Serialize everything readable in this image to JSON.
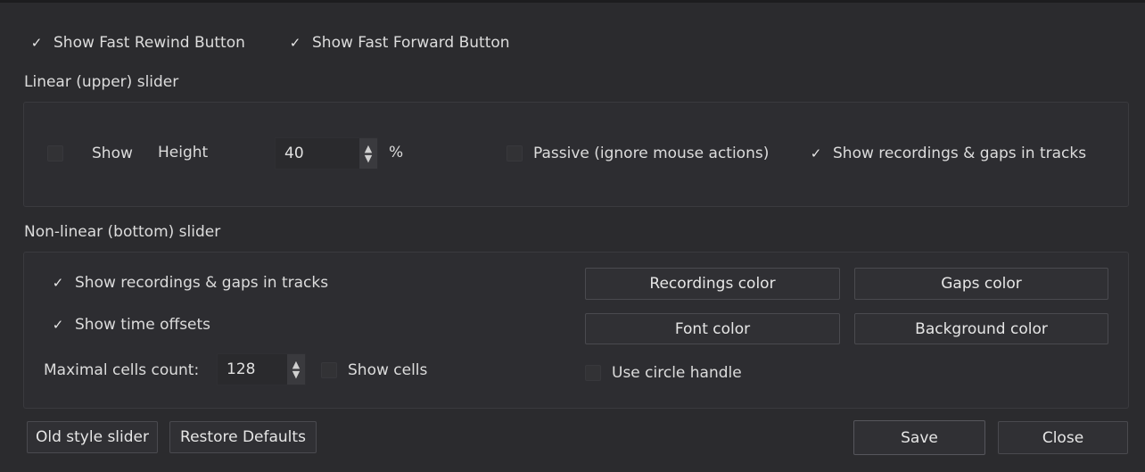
{
  "top_options": {
    "fast_rewind": {
      "checked": true,
      "label": "Show Fast Rewind Button"
    },
    "fast_forward": {
      "checked": true,
      "label": "Show Fast Forward Button"
    }
  },
  "linear_slider": {
    "title": "Linear (upper) slider",
    "show": {
      "checked": false,
      "label": "Show"
    },
    "height_label": "Height",
    "height_value": "40",
    "height_unit": "%",
    "passive": {
      "checked": false,
      "label": "Passive (ignore mouse actions)"
    },
    "show_recordings": {
      "checked": true,
      "label": "Show recordings & gaps in tracks"
    }
  },
  "nonlinear_slider": {
    "title": "Non-linear (bottom) slider",
    "show_recordings": {
      "checked": true,
      "label": "Show recordings & gaps in tracks"
    },
    "show_time_offsets": {
      "checked": true,
      "label": "Show time offsets"
    },
    "max_cells_label": "Maximal cells count:",
    "max_cells_value": "128",
    "show_cells": {
      "checked": false,
      "label": "Show cells"
    },
    "recordings_color_label": "Recordings color",
    "gaps_color_label": "Gaps color",
    "font_color_label": "Font color",
    "background_color_label": "Background color",
    "use_circle_handle": {
      "checked": false,
      "label": "Use circle handle"
    }
  },
  "footer": {
    "old_style_label": "Old style slider",
    "restore_defaults_label": "Restore Defaults",
    "save_label": "Save",
    "close_label": "Close"
  },
  "glyphs": {
    "check": "✓",
    "up": "▲",
    "down": "▼"
  },
  "colors": {
    "background": "#2b2b2e",
    "group": "#2d2d31",
    "text": "#dcdcdc"
  }
}
